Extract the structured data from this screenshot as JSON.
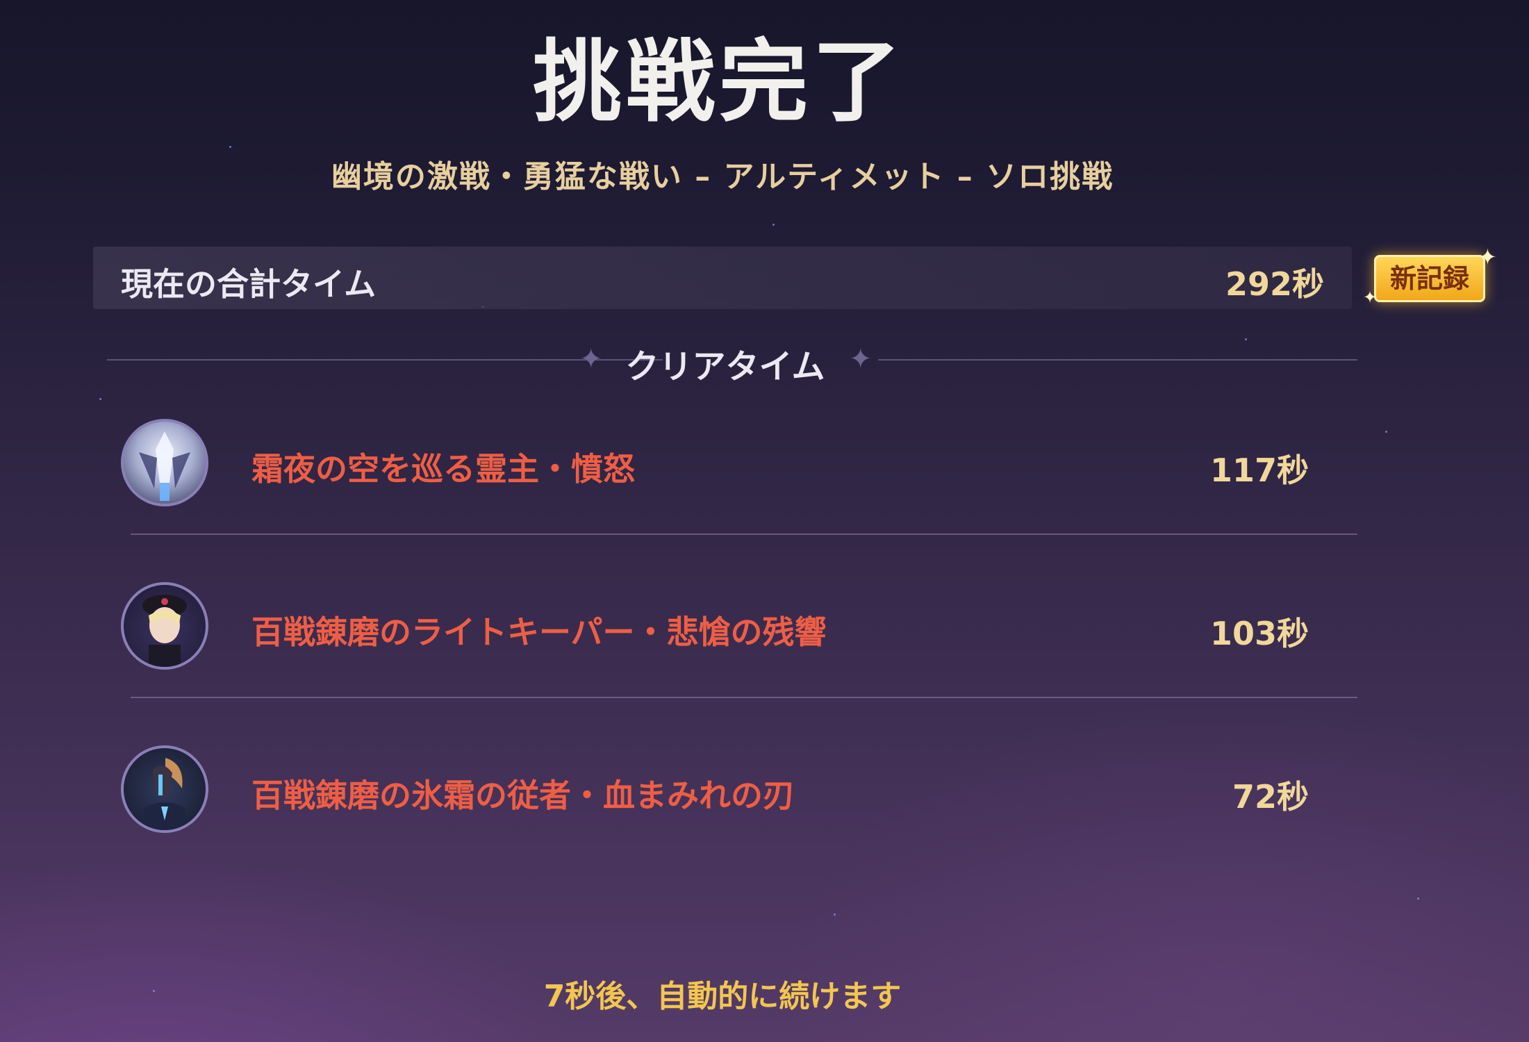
{
  "header": {
    "title": "挑戦完了",
    "subtitle": "幽境の激戦・勇猛な戦い – アルティメット – ソロ挑戦"
  },
  "total": {
    "label": "現在の合計タイム",
    "value": "292秒",
    "badge": "新記録"
  },
  "section": {
    "label": "クリアタイム"
  },
  "bosses": [
    {
      "name": "霜夜の空を巡る霊主・憤怒",
      "time": "117秒",
      "icon": "frost-lord-portrait"
    },
    {
      "name": "百戦錬磨のライトキーパー・悲愴の残響",
      "time": "103秒",
      "icon": "lightkeeper-portrait"
    },
    {
      "name": "百戦錬磨の氷霜の従者・血まみれの刃",
      "time": "72秒",
      "icon": "frost-retainer-portrait"
    }
  ],
  "footer": {
    "auto_continue": "7秒後、自動的に続けます"
  },
  "colors": {
    "title": "#f2f0ec",
    "subtitle": "#e7cf9e",
    "boss_name": "#ee5e45",
    "time": "#f1d79a",
    "badge": "#f2a71a",
    "auto_continue": "#f3c64f"
  }
}
